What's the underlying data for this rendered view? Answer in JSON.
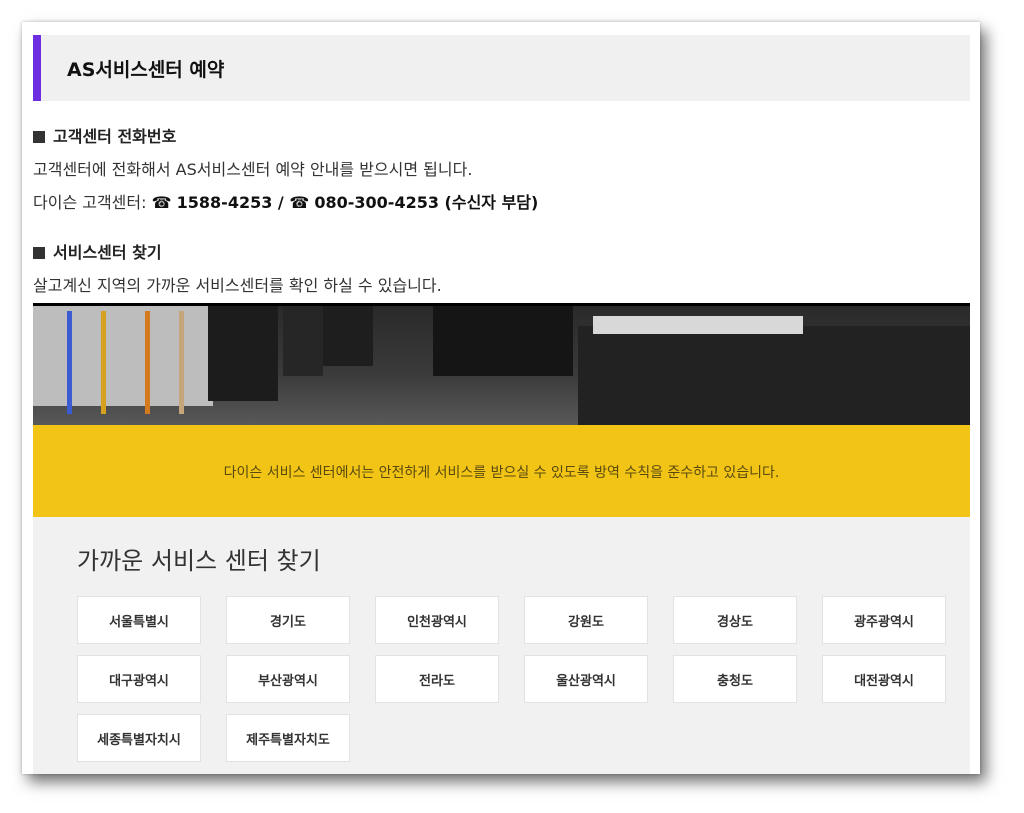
{
  "page": {
    "title": "AS서비스센터 예약",
    "accent_color": "#6c2ee0"
  },
  "phone_section": {
    "heading": "고객센터 전화번호",
    "line1": "고객센터에 전화해서 AS서비스센터 예약 안내를 받으시면 됩니다.",
    "line2_prefix": "다이슨 고객센터: ",
    "phone_icon": "☎",
    "phone1": "1588-4253",
    "separator": " / ",
    "phone2": "080-300-4253 (수신자 부담)"
  },
  "center_section": {
    "heading": "서비스센터 찾기",
    "line1": "살고계신 지역의 가까운 서비스센터를 확인 하실 수 있습니다."
  },
  "notice": {
    "text": "다이슨 서비스 센터에서는 안전하게 서비스를 받으실 수 있도록 방역 수칙을 준수하고 있습니다.",
    "bg_color": "#f2c416"
  },
  "finder": {
    "heading": "가까운 서비스 센터 찾기",
    "regions": [
      "서울특별시",
      "경기도",
      "인천광역시",
      "강원도",
      "경상도",
      "광주광역시",
      "대구광역시",
      "부산광역시",
      "전라도",
      "울산광역시",
      "충청도",
      "대전광역시",
      "세종특별자치시",
      "제주특별자치도"
    ]
  }
}
